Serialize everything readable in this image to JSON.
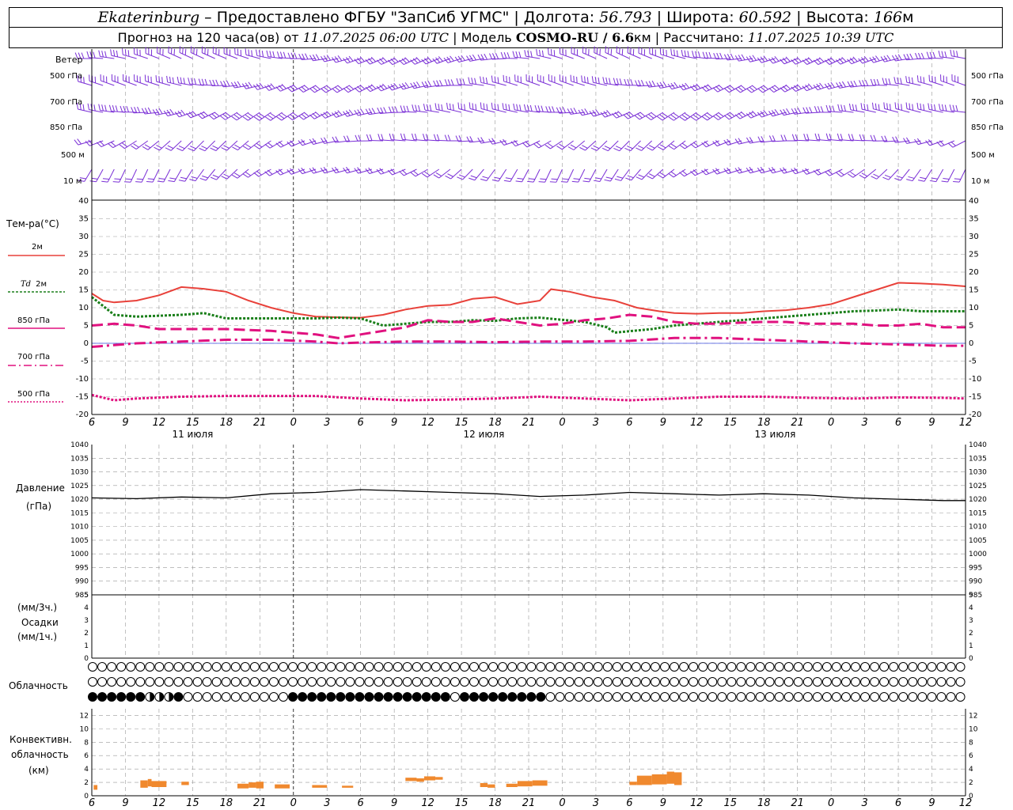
{
  "header": {
    "city": "Ekaterinburg",
    "provider": " – Предоставлено ФГБУ \"ЗапСиб УГМС\" | Долгота: ",
    "lon": "56.793",
    "lat_label": " | Широта: ",
    "lat": "60.592",
    "alt_label": " | Высота: ",
    "alt": "166",
    "alt_unit": "м",
    "forecast_label": "Прогноз на 120 часа(ов) от ",
    "forecast_from": "11.07.2025 06:00 UTC",
    "model_label": " | Модель ",
    "model": "COSMO-RU / 6.6",
    "model_unit": "км",
    "calc_label": " | Рассчитано: ",
    "calc": "11.07.2025 10:39 UTC"
  },
  "labels": {
    "wind": "Ветер",
    "wind_levels": [
      "500 гПа",
      "700 гПа",
      "850 гПа",
      "500 м",
      "10 м"
    ],
    "temp_title": "Тем-ра(°C)",
    "temp_2m": "2м",
    "td_name": "Td",
    "td_2m": "2м",
    "t850": "850 гПа",
    "t700": "700 гПа",
    "t500": "500 гПа",
    "pressure": "Давление",
    "pressure_unit": "(гПа)",
    "precip_3h": "(мм/3ч.)",
    "precip": "Осадки",
    "precip_1h": "(мм/1ч.)",
    "cloud": "Облачность",
    "conv1": "Конвективн.",
    "conv2": "облачность",
    "conv3": "(км)"
  },
  "chart_data": {
    "type": "line",
    "x_hours": [
      0,
      3,
      6,
      9,
      12,
      15,
      18,
      21,
      24,
      27,
      30,
      33,
      36,
      39,
      42,
      45,
      48,
      51,
      54,
      57,
      60,
      63,
      66,
      69,
      72,
      75,
      78,
      81,
      84,
      87,
      90,
      93,
      96,
      99,
      102,
      105,
      108,
      111,
      114,
      117,
      120,
      123,
      126,
      129,
      132,
      135,
      138,
      141,
      144,
      147,
      150,
      153,
      156,
      159,
      162,
      165,
      168,
      171,
      174,
      177,
      180,
      183,
      186,
      189,
      192,
      195,
      198,
      201,
      204,
      207,
      210,
      213,
      216,
      219,
      222,
      225,
      228,
      231,
      234
    ],
    "x_tick_labels": [
      "6",
      "9",
      "12",
      "15",
      "18",
      "21",
      "0",
      "3",
      "6",
      "9",
      "12",
      "15",
      "18",
      "21",
      "0",
      "3",
      "6",
      "9",
      "12",
      "15",
      "18",
      "21",
      "0",
      "3",
      "6",
      "9",
      "12"
    ],
    "day_labels": [
      "11 июля",
      "12 июля",
      "13 июля"
    ],
    "wind_levels": [
      "500 гПа",
      "700 гПа",
      "850 гПа",
      "500 м",
      "10 м"
    ],
    "wind_dir_deg": [
      270,
      265,
      260,
      250,
      230
    ],
    "temperature": {
      "ylim": [
        -20,
        40
      ],
      "yticks": [
        -20,
        -15,
        -10,
        -5,
        0,
        5,
        10,
        15,
        20,
        25,
        30,
        35,
        40
      ],
      "series": [
        {
          "name": "2м",
          "color": "#e8413a",
          "style": "solid",
          "width": 2,
          "values": [
            [
              0,
              14
            ],
            [
              3,
              12
            ],
            [
              6,
              11.5
            ],
            [
              12,
              12
            ],
            [
              18,
              13.5
            ],
            [
              24,
              15.8
            ],
            [
              30,
              15.3
            ],
            [
              36,
              14.5
            ],
            [
              42,
              12
            ],
            [
              48,
              10
            ],
            [
              54,
              8.5
            ],
            [
              60,
              7.5
            ],
            [
              66,
              7.3
            ],
            [
              72,
              7.2
            ],
            [
              78,
              8
            ],
            [
              84,
              9.5
            ],
            [
              90,
              10.5
            ],
            [
              96,
              10.8
            ],
            [
              102,
              12.5
            ],
            [
              108,
              13
            ],
            [
              114,
              11
            ],
            [
              120,
              12
            ],
            [
              123,
              15.2
            ],
            [
              128,
              14.5
            ],
            [
              134,
              13
            ],
            [
              140,
              12
            ],
            [
              146,
              10
            ],
            [
              152,
              9
            ],
            [
              156,
              8.5
            ],
            [
              162,
              8.3
            ],
            [
              168,
              8.5
            ],
            [
              174,
              8.5
            ],
            [
              180,
              9
            ],
            [
              186,
              9.3
            ],
            [
              192,
              10
            ],
            [
              198,
              11
            ],
            [
              204,
              13
            ],
            [
              210,
              15
            ],
            [
              216,
              17
            ],
            [
              222,
              16.8
            ],
            [
              228,
              16.5
            ],
            [
              234,
              16
            ]
          ]
        },
        {
          "name": "Td",
          "color": "#1a7f1a",
          "style": "dot",
          "width": 3,
          "values": [
            [
              0,
              13
            ],
            [
              6,
              8
            ],
            [
              12,
              7.5
            ],
            [
              24,
              8
            ],
            [
              30,
              8.5
            ],
            [
              36,
              7
            ],
            [
              48,
              7
            ],
            [
              60,
              7
            ],
            [
              66,
              7.2
            ],
            [
              72,
              7
            ],
            [
              78,
              5
            ],
            [
              84,
              5.5
            ],
            [
              90,
              6
            ],
            [
              96,
              6
            ],
            [
              102,
              6.5
            ],
            [
              108,
              6.3
            ],
            [
              114,
              7
            ],
            [
              120,
              7.2
            ],
            [
              132,
              6
            ],
            [
              138,
              4.5
            ],
            [
              140,
              3
            ],
            [
              150,
              4
            ],
            [
              156,
              5
            ],
            [
              168,
              6
            ],
            [
              180,
              7
            ],
            [
              192,
              8
            ],
            [
              204,
              9
            ],
            [
              210,
              9.2
            ],
            [
              216,
              9.5
            ],
            [
              222,
              9
            ],
            [
              234,
              9
            ]
          ]
        },
        {
          "name": "850 гПа",
          "color": "#e0117f",
          "style": "dash",
          "width": 3,
          "values": [
            [
              0,
              5
            ],
            [
              6,
              5.5
            ],
            [
              12,
              5
            ],
            [
              18,
              4
            ],
            [
              24,
              4
            ],
            [
              30,
              4
            ],
            [
              36,
              4
            ],
            [
              48,
              3.5
            ],
            [
              60,
              2.5
            ],
            [
              66,
              1.5
            ],
            [
              72,
              2.5
            ],
            [
              78,
              3.5
            ],
            [
              84,
              4.5
            ],
            [
              90,
              6.5
            ],
            [
              96,
              6
            ],
            [
              102,
              6
            ],
            [
              108,
              7
            ],
            [
              114,
              6
            ],
            [
              120,
              5
            ],
            [
              126,
              5.5
            ],
            [
              132,
              6.5
            ],
            [
              138,
              7
            ],
            [
              144,
              8
            ],
            [
              150,
              7.5
            ],
            [
              156,
              6
            ],
            [
              162,
              5.5
            ],
            [
              168,
              5.5
            ],
            [
              174,
              5.8
            ],
            [
              180,
              6
            ],
            [
              186,
              6
            ],
            [
              192,
              5.5
            ],
            [
              204,
              5.5
            ],
            [
              210,
              5
            ],
            [
              216,
              5
            ],
            [
              222,
              5.5
            ],
            [
              228,
              4.5
            ],
            [
              234,
              4.5
            ]
          ]
        },
        {
          "name": "700 гПа",
          "color": "#e0117f",
          "style": "dashdot",
          "width": 3,
          "values": [
            [
              0,
              -1
            ],
            [
              6,
              -0.5
            ],
            [
              12,
              0
            ],
            [
              24,
              0.5
            ],
            [
              36,
              1
            ],
            [
              48,
              1
            ],
            [
              60,
              0.5
            ],
            [
              66,
              0
            ],
            [
              72,
              0.2
            ],
            [
              84,
              0.5
            ],
            [
              96,
              0.5
            ],
            [
              108,
              0.3
            ],
            [
              120,
              0.5
            ],
            [
              132,
              0.5
            ],
            [
              144,
              0.7
            ],
            [
              156,
              1.5
            ],
            [
              168,
              1.5
            ],
            [
              180,
              1
            ],
            [
              192,
              0.5
            ],
            [
              204,
              0
            ],
            [
              216,
              -0.3
            ],
            [
              228,
              -0.7
            ],
            [
              234,
              -0.7
            ]
          ]
        },
        {
          "name": "500 гПа",
          "color": "#e0117f",
          "style": "dot",
          "width": 3,
          "values": [
            [
              0,
              -14.5
            ],
            [
              6,
              -16
            ],
            [
              12,
              -15.5
            ],
            [
              24,
              -15
            ],
            [
              36,
              -14.8
            ],
            [
              48,
              -14.8
            ],
            [
              60,
              -14.8
            ],
            [
              72,
              -15.5
            ],
            [
              84,
              -16
            ],
            [
              96,
              -15.8
            ],
            [
              108,
              -15.5
            ],
            [
              120,
              -15
            ],
            [
              132,
              -15.5
            ],
            [
              144,
              -16
            ],
            [
              156,
              -15.5
            ],
            [
              168,
              -15
            ],
            [
              174,
              -15
            ],
            [
              180,
              -15
            ],
            [
              192,
              -15.3
            ],
            [
              204,
              -15.5
            ],
            [
              216,
              -15.2
            ],
            [
              228,
              -15.3
            ],
            [
              234,
              -15.5
            ]
          ]
        }
      ]
    },
    "pressure": {
      "ylim": [
        985,
        1040
      ],
      "yticks": [
        985,
        990,
        995,
        1000,
        1005,
        1010,
        1015,
        1020,
        1025,
        1030,
        1035,
        1040
      ],
      "values": [
        [
          0,
          1020.5
        ],
        [
          12,
          1020.2
        ],
        [
          24,
          1020.8
        ],
        [
          36,
          1020.5
        ],
        [
          48,
          1022
        ],
        [
          60,
          1022.5
        ],
        [
          72,
          1023.5
        ],
        [
          84,
          1023
        ],
        [
          96,
          1022.5
        ],
        [
          108,
          1022
        ],
        [
          120,
          1021
        ],
        [
          132,
          1021.5
        ],
        [
          144,
          1022.5
        ],
        [
          156,
          1022
        ],
        [
          168,
          1021.5
        ],
        [
          180,
          1022
        ],
        [
          192,
          1021.5
        ],
        [
          204,
          1020.5
        ],
        [
          216,
          1020
        ],
        [
          228,
          1019.5
        ],
        [
          234,
          1019.5
        ]
      ]
    },
    "precip": {
      "ylim": [
        0,
        5
      ],
      "yticks": [
        0,
        1,
        2,
        3,
        4,
        5
      ],
      "values": []
    },
    "cloud_rows": {
      "upper": "0000000000000000000000000000000000000000000000000000000000000000000000000000000000000000000000000000000000000000000000000000000000000000000000000000000000000000000000000000000000000000000000000000000000000000000000000000000000000000000",
      "middle": "0000000000000000000000000000000000000000000000000000000000000000000000000000000000000000000000000000000000000000000000000000000000000000000000000000000000000000000000000000000000000000000000000000000000000000000000000000000000000000000",
      "lower": "4444442224000000000004444444444444444404444444440000000000000000000000000000000000000000000000000000000000000000000000000000000000000000000000000000000000000000000000000000000000000000000000000000000000000000000000000000000000000"
    },
    "convective": {
      "ylim": [
        0,
        13
      ],
      "yticks": [
        0,
        2,
        4,
        6,
        8,
        10,
        12
      ],
      "bars": [
        [
          0.5,
          1.5,
          0.9,
          1.6
        ],
        [
          13,
          15,
          1.2,
          2.3
        ],
        [
          15,
          16,
          1.4,
          2.5
        ],
        [
          16,
          20,
          1.3,
          2.2
        ],
        [
          24,
          26,
          1.6,
          2.1
        ],
        [
          39,
          42,
          1.1,
          1.8
        ],
        [
          42,
          44,
          1.2,
          2
        ],
        [
          44,
          46,
          1.1,
          2.1
        ],
        [
          49,
          53,
          1.1,
          1.7
        ],
        [
          59,
          63,
          1.2,
          1.6
        ],
        [
          67,
          70,
          1.2,
          1.5
        ],
        [
          84,
          87,
          2.2,
          2.7
        ],
        [
          87,
          89,
          2.1,
          2.6
        ],
        [
          89,
          92,
          2.3,
          2.9
        ],
        [
          92,
          94,
          2.4,
          2.8
        ],
        [
          104,
          106,
          1.3,
          1.9
        ],
        [
          106,
          108,
          1.2,
          1.7
        ],
        [
          111,
          114,
          1.3,
          1.8
        ],
        [
          114,
          118,
          1.4,
          2.2
        ],
        [
          118,
          122,
          1.5,
          2.3
        ],
        [
          144,
          146,
          1.6,
          2.1
        ],
        [
          146,
          150,
          1.6,
          3
        ],
        [
          150,
          154,
          1.7,
          3.2
        ],
        [
          154,
          156,
          1.8,
          3.6
        ],
        [
          156,
          158,
          1.6,
          3.5
        ]
      ]
    }
  }
}
